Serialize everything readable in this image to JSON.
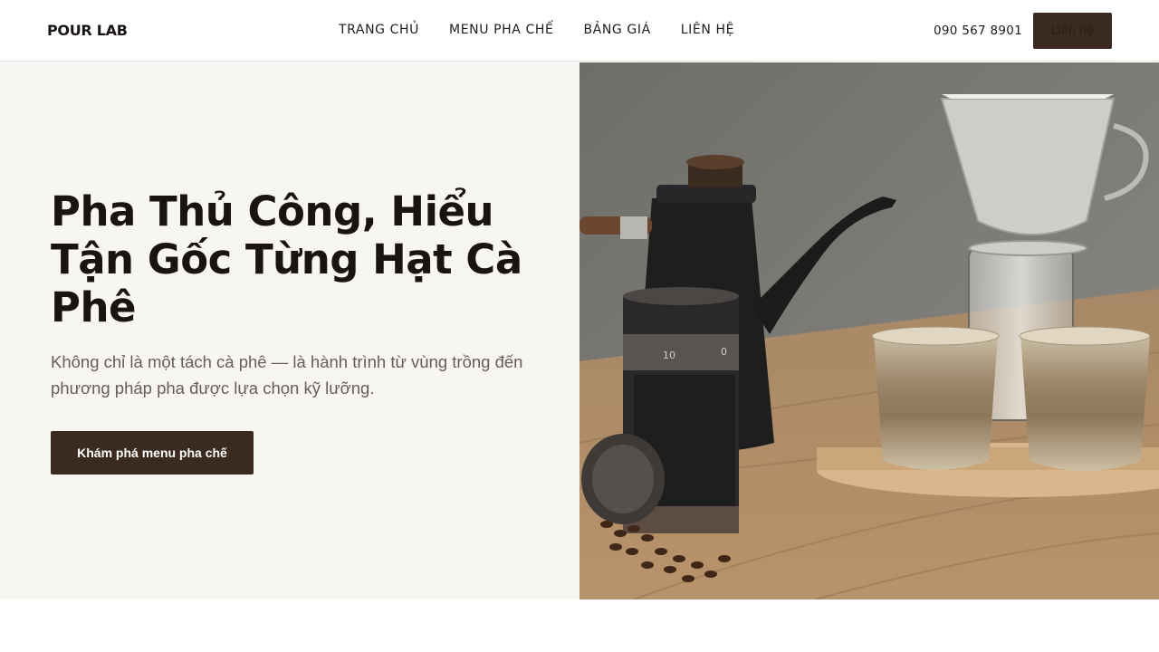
{
  "brand": {
    "logo": "POUR LAB"
  },
  "nav": {
    "items": [
      "TRANG CHỦ",
      "MENU PHA CHẾ",
      "BẢNG GIÁ",
      "LIÊN HỆ"
    ]
  },
  "header": {
    "phone": "090 567 8901",
    "cta_label": "Liên hệ"
  },
  "hero": {
    "title": "Pha Thủ Công, Hiểu Tận Gốc Từng Hạt Cà Phê",
    "subtitle": "Không chỉ là một tách cà phê — là hành trình từ vùng trồng đến phương pháp pha được lựa chọn kỹ lưỡng.",
    "button_label": "Khám phá menu pha chế",
    "image": {
      "grinder_marks": [
        "10",
        "0"
      ],
      "subject": "pour-over-coffee-set-photo"
    }
  },
  "colors": {
    "accent": "#3b2a20",
    "hero_bg": "#f8f6f2",
    "text_muted": "#6a5d55"
  }
}
